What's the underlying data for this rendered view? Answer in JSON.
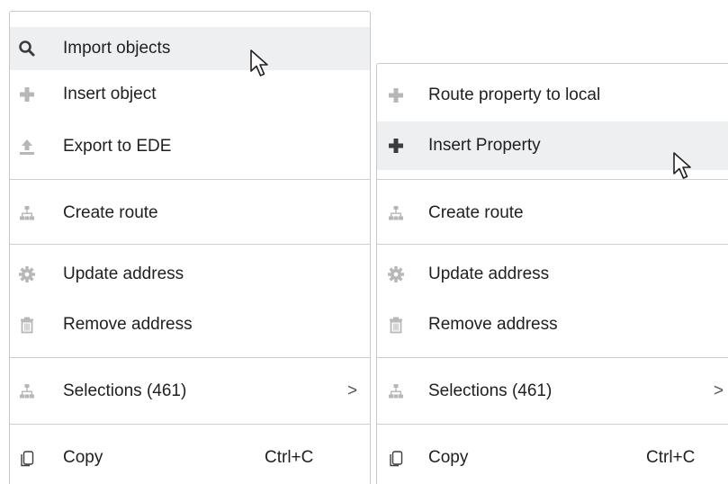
{
  "left_menu": {
    "items": [
      {
        "label": "Import objects",
        "icon": "search-icon"
      },
      {
        "label": "Insert object",
        "icon": "plus-icon"
      },
      {
        "label": "Export to EDE",
        "icon": "upload-icon"
      },
      {
        "label": "Create route",
        "icon": "hierarchy-icon"
      },
      {
        "label": "Update address",
        "icon": "gear-icon"
      },
      {
        "label": "Remove address",
        "icon": "trash-icon"
      },
      {
        "label": "Selections (461)",
        "icon": "hierarchy-icon",
        "submenu_indicator": ">"
      },
      {
        "label": "Copy",
        "icon": "copy-icon",
        "shortcut": "Ctrl+C"
      }
    ],
    "highlighted": "Import objects"
  },
  "right_menu": {
    "items": [
      {
        "label": "Route property to local",
        "icon": "plus-icon"
      },
      {
        "label": "Insert Property",
        "icon": "plus-icon"
      },
      {
        "label": "Create route",
        "icon": "hierarchy-icon"
      },
      {
        "label": "Update address",
        "icon": "gear-icon"
      },
      {
        "label": "Remove address",
        "icon": "trash-icon"
      },
      {
        "label": "Selections (461)",
        "icon": "hierarchy-icon",
        "submenu_indicator": ">"
      },
      {
        "label": "Copy",
        "icon": "copy-icon",
        "shortcut": "Ctrl+C"
      }
    ],
    "highlighted": "Insert Property"
  },
  "colors": {
    "hover_background": "#edeff1",
    "icon_gray": "#b7b7b7",
    "icon_dark": "#3c3c3c",
    "separator": "#cfcfcf",
    "text": "#1f1f1f"
  }
}
